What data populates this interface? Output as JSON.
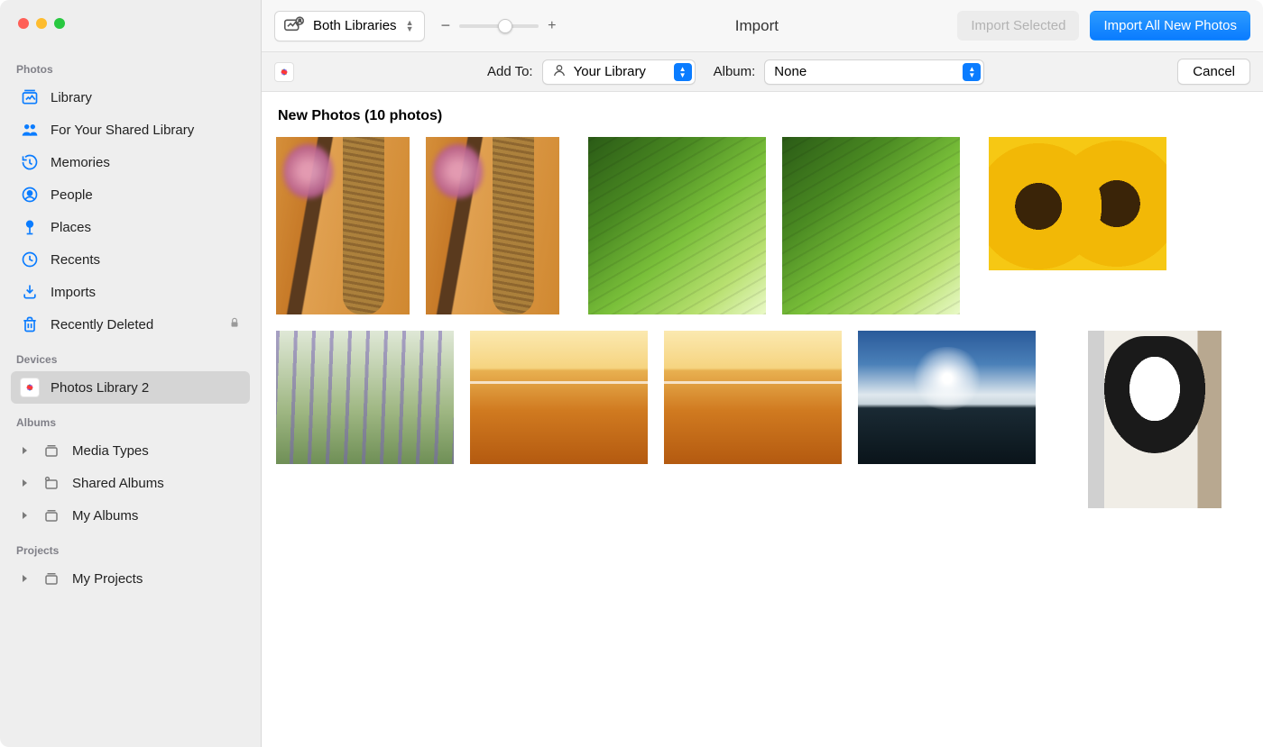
{
  "sidebar": {
    "sections": {
      "photos": {
        "label": "Photos",
        "items": [
          {
            "label": "Library",
            "icon": "photo-stack"
          },
          {
            "label": "For Your Shared Library",
            "icon": "people"
          },
          {
            "label": "Memories",
            "icon": "clock-rewind"
          },
          {
            "label": "People",
            "icon": "person-circle"
          },
          {
            "label": "Places",
            "icon": "pin"
          },
          {
            "label": "Recents",
            "icon": "clock"
          },
          {
            "label": "Imports",
            "icon": "import"
          },
          {
            "label": "Recently Deleted",
            "icon": "trash",
            "trailing": "lock"
          }
        ]
      },
      "devices": {
        "label": "Devices",
        "items": [
          {
            "label": "Photos Library 2",
            "icon": "photos-app",
            "selected": true
          }
        ]
      },
      "albums": {
        "label": "Albums",
        "items": [
          {
            "label": "Media Types",
            "disclosure": true
          },
          {
            "label": "Shared Albums",
            "disclosure": true
          },
          {
            "label": "My Albums",
            "disclosure": true
          }
        ]
      },
      "projects": {
        "label": "Projects",
        "items": [
          {
            "label": "My Projects",
            "disclosure": true
          }
        ]
      }
    }
  },
  "toolbar": {
    "library_selector": "Both Libraries",
    "zoom_minus": "−",
    "zoom_plus": "+",
    "title": "Import",
    "import_selected": "Import Selected",
    "import_all": "Import All New Photos"
  },
  "optionbar": {
    "add_to_label": "Add To:",
    "add_to_value": "Your Library",
    "album_label": "Album:",
    "album_value": "None",
    "cancel": "Cancel"
  },
  "content": {
    "group_title": "New Photos (10 photos)",
    "photo_count": 10
  }
}
